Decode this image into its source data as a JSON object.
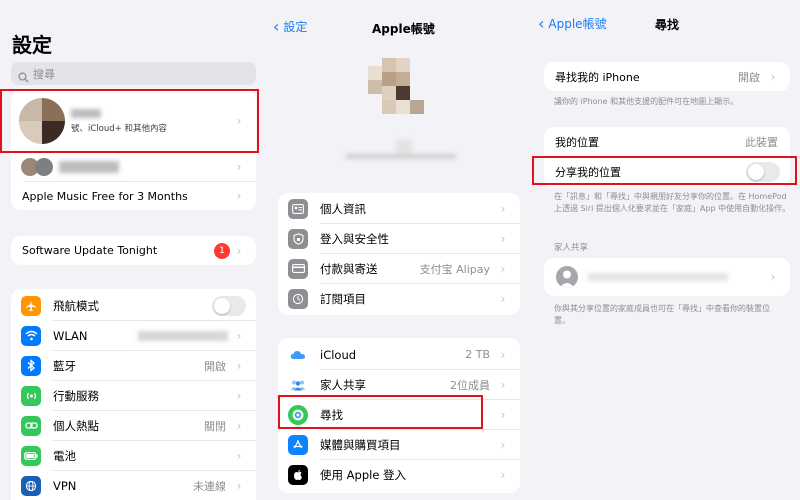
{
  "settings": {
    "title": "設定",
    "search_placeholder": "搜尋",
    "account_subtitle": "號、iCloud+ 和其他內容",
    "promo": "Apple Music Free for 3 Months",
    "update": "Software Update Tonight",
    "update_badge": "1",
    "items": [
      {
        "label": "飛航模式",
        "value": "",
        "icon": "airplane-icon",
        "color": "#ff9500"
      },
      {
        "label": "WLAN",
        "value": "",
        "icon": "wifi-icon",
        "color": "#007aff"
      },
      {
        "label": "藍牙",
        "value": "開啟",
        "icon": "bluetooth-icon",
        "color": "#007aff"
      },
      {
        "label": "行動服務",
        "value": "",
        "icon": "cellular-icon",
        "color": "#34c759"
      },
      {
        "label": "個人熱點",
        "value": "關閉",
        "icon": "hotspot-icon",
        "color": "#34c759"
      },
      {
        "label": "電池",
        "value": "",
        "icon": "battery-icon",
        "color": "#34c759"
      },
      {
        "label": "VPN",
        "value": "未連線",
        "icon": "vpn-icon",
        "color": "#1a5fb4"
      }
    ]
  },
  "apple_account": {
    "back": "設定",
    "title": "Apple帳號",
    "group1": [
      {
        "label": "個人資訊",
        "value": "",
        "icon": "contact-card-icon",
        "color": "#8e8e93"
      },
      {
        "label": "登入與安全性",
        "value": "",
        "icon": "shield-icon",
        "color": "#8e8e93"
      },
      {
        "label": "付款與寄送",
        "value": "支付宝 Alipay",
        "icon": "credit-card-icon",
        "color": "#8e8e93"
      },
      {
        "label": "訂閱項目",
        "value": "",
        "icon": "subscription-icon",
        "color": "#8e8e93"
      }
    ],
    "group2": [
      {
        "label": "iCloud",
        "value": "2 TB",
        "icon": "icloud-icon",
        "color": "#ffffff"
      },
      {
        "label": "家人共享",
        "value": "2位成員",
        "icon": "family-icon",
        "color": "#ffffff"
      },
      {
        "label": "尋找",
        "value": "",
        "icon": "find-my-icon",
        "color": "#34c759"
      },
      {
        "label": "媒體與購買項目",
        "value": "",
        "icon": "app-store-icon",
        "color": "#0a84ff"
      },
      {
        "label": "使用 Apple 登入",
        "value": "",
        "icon": "apple-icon",
        "color": "#000000"
      }
    ]
  },
  "find_my": {
    "back": "Apple帳號",
    "title": "尋找",
    "find_iphone_label": "尋找我的 iPhone",
    "find_iphone_value": "開啟",
    "find_iphone_caption": "讓你的 iPhone 和其他支援的配件可在地圖上顯示。",
    "my_location_label": "我的位置",
    "my_location_value": "此裝置",
    "share_location_label": "分享我的位置",
    "share_caption": "在「訊息」和「尋找」中與親朋好友分享你的位置。在 HomePod 上透過 Siri 提出個人化要求並在「家庭」App 中使用自動化操作。",
    "family_header": "家人共享",
    "family_caption": "你與其分享位置的家庭成員也可在「尋找」中查看你的裝置位置。"
  }
}
